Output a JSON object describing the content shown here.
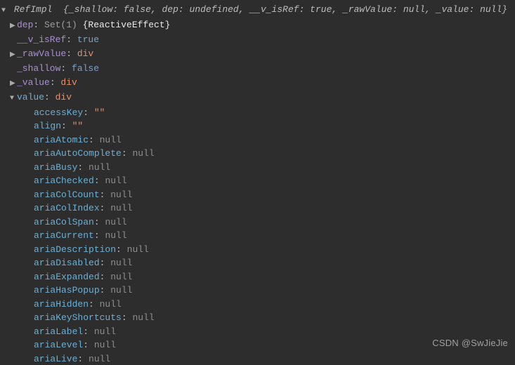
{
  "header": {
    "class_name": "RefImpl",
    "preview": [
      {
        "key": "_shallow",
        "val": "false",
        "vt": "bool"
      },
      {
        "key": "dep",
        "val": "undefined",
        "vt": "undef"
      },
      {
        "key": "__v_isRef",
        "val": "true",
        "vt": "bool"
      },
      {
        "key": "_rawValue",
        "val": "null",
        "vt": "null"
      },
      {
        "key": "_value",
        "val": "null",
        "vt": "null"
      }
    ]
  },
  "top_rows": [
    {
      "arrow": "▶",
      "key": "dep",
      "colon": ": ",
      "extra": "Set(1) ",
      "extra2": "{ReactiveEffect}"
    },
    {
      "arrow": "",
      "key": "__v_isRef",
      "val": "true",
      "vt": "bool"
    },
    {
      "arrow": "▶",
      "key": "_rawValue",
      "val": "div",
      "vt": "str"
    },
    {
      "arrow": "",
      "key": "_shallow",
      "val": "false",
      "vt": "bool"
    },
    {
      "arrow": "▶",
      "key": "_value",
      "val": "div",
      "vt": "str"
    },
    {
      "arrow": "▼",
      "key": "value",
      "val": "div",
      "vt": "str",
      "open": true
    }
  ],
  "value_children": [
    {
      "key": "accessKey",
      "val": "\"\"",
      "vt": "str"
    },
    {
      "key": "align",
      "val": "\"\"",
      "vt": "str"
    },
    {
      "key": "ariaAtomic",
      "val": "null",
      "vt": "null"
    },
    {
      "key": "ariaAutoComplete",
      "val": "null",
      "vt": "null"
    },
    {
      "key": "ariaBusy",
      "val": "null",
      "vt": "null"
    },
    {
      "key": "ariaChecked",
      "val": "null",
      "vt": "null"
    },
    {
      "key": "ariaColCount",
      "val": "null",
      "vt": "null"
    },
    {
      "key": "ariaColIndex",
      "val": "null",
      "vt": "null"
    },
    {
      "key": "ariaColSpan",
      "val": "null",
      "vt": "null"
    },
    {
      "key": "ariaCurrent",
      "val": "null",
      "vt": "null"
    },
    {
      "key": "ariaDescription",
      "val": "null",
      "vt": "null"
    },
    {
      "key": "ariaDisabled",
      "val": "null",
      "vt": "null"
    },
    {
      "key": "ariaExpanded",
      "val": "null",
      "vt": "null"
    },
    {
      "key": "ariaHasPopup",
      "val": "null",
      "vt": "null"
    },
    {
      "key": "ariaHidden",
      "val": "null",
      "vt": "null"
    },
    {
      "key": "ariaKeyShortcuts",
      "val": "null",
      "vt": "null"
    },
    {
      "key": "ariaLabel",
      "val": "null",
      "vt": "null"
    },
    {
      "key": "ariaLevel",
      "val": "null",
      "vt": "null"
    },
    {
      "key": "ariaLive",
      "val": "null",
      "vt": "null"
    }
  ],
  "watermark": "CSDN @SwJieJie"
}
